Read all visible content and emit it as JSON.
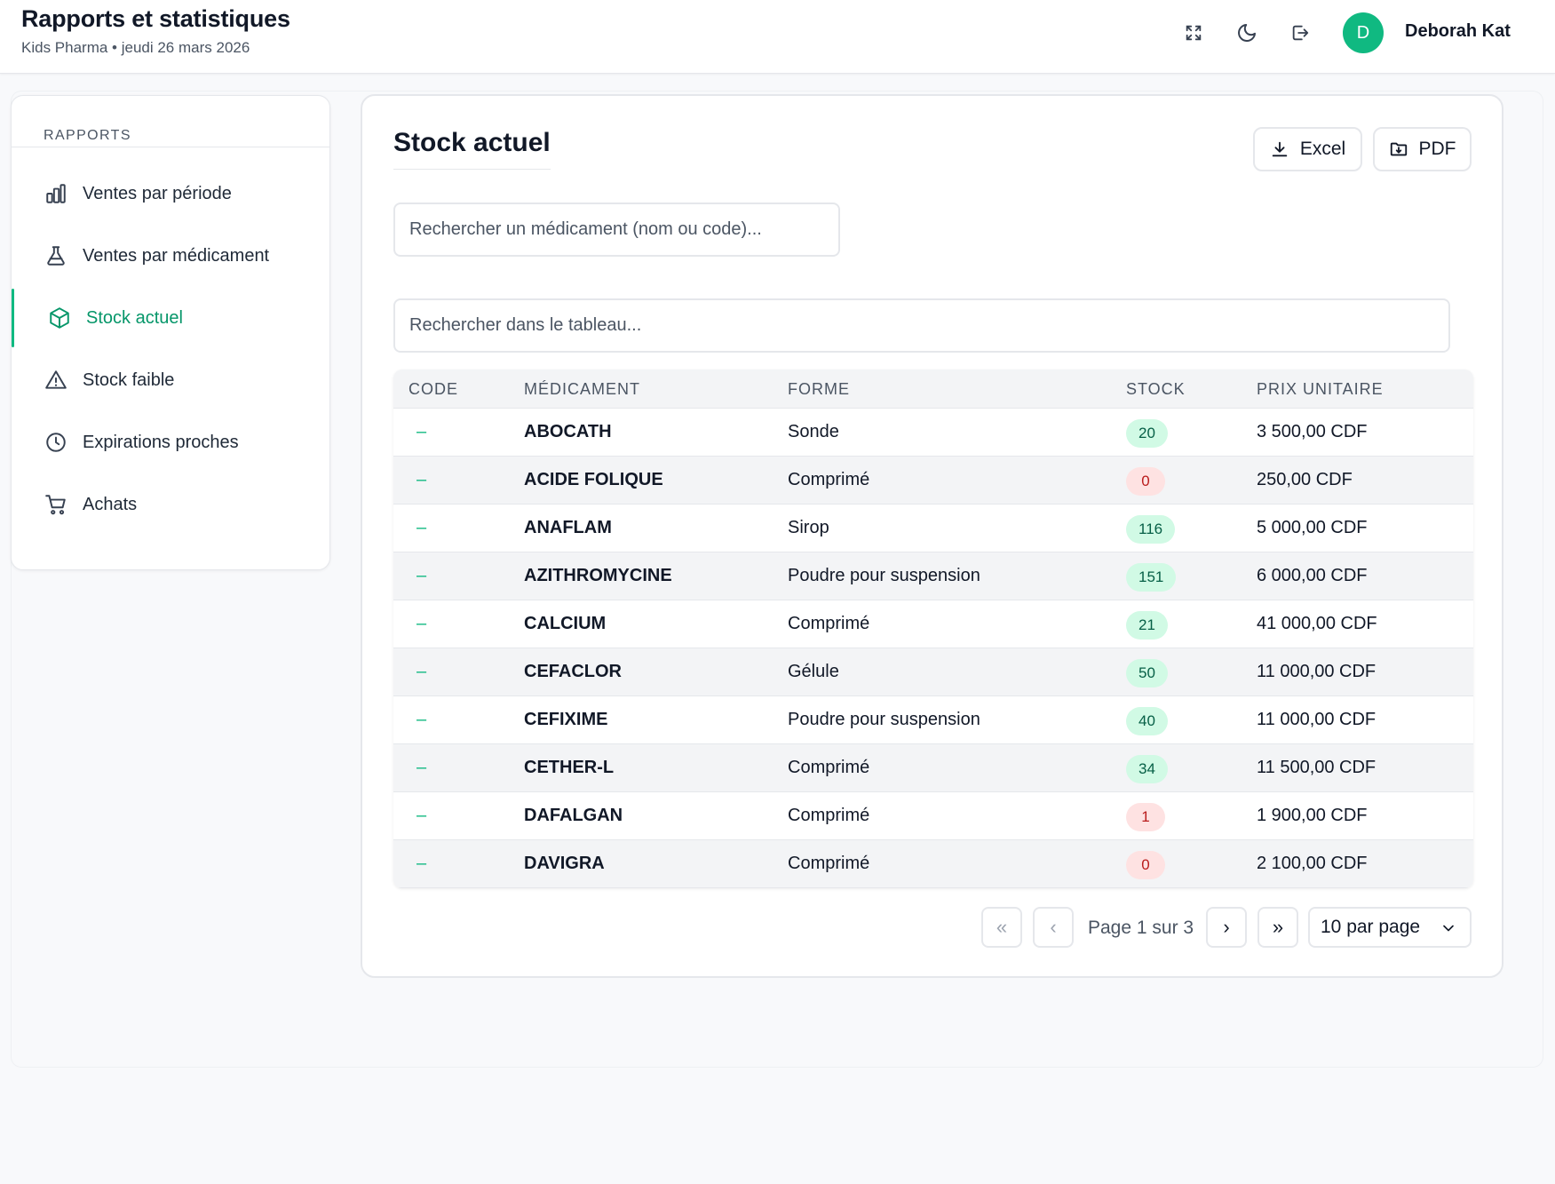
{
  "header": {
    "title": "Rapports et statistiques",
    "subtitle": "Kids Pharma • jeudi 26 mars 2026",
    "icons": [
      "fullscreen-icon",
      "moon-icon",
      "logout-icon"
    ],
    "avatar_initial": "D",
    "user_name": "Deborah Kat"
  },
  "sidebar": {
    "section_label": "RAPPORTS",
    "items": [
      {
        "label": "Ventes par période",
        "icon": "bar-chart-icon"
      },
      {
        "label": "Ventes par médicament",
        "icon": "flask-icon"
      },
      {
        "label": "Stock actuel",
        "icon": "box-icon",
        "active": true
      },
      {
        "label": "Stock faible",
        "icon": "warning-icon"
      },
      {
        "label": "Expirations proches",
        "icon": "clock-icon"
      },
      {
        "label": "Achats",
        "icon": "cart-icon"
      }
    ]
  },
  "main": {
    "title": "Stock actuel",
    "excel_label": "Excel",
    "pdf_label": "PDF",
    "search_medicament_placeholder": "Rechercher un médicament (nom ou code)...",
    "search_table_placeholder": "Rechercher dans le tableau...",
    "table": {
      "columns": [
        "CODE",
        "MÉDICAMENT",
        "FORME",
        "STOCK",
        "PRIX UNITAIRE"
      ],
      "rows": [
        {
          "code": "–",
          "name": "ABOCATH",
          "forme": "Sonde",
          "stock": "20",
          "price": "3 500,00 CDF",
          "level": "ok"
        },
        {
          "code": "–",
          "name": "ACIDE FOLIQUE",
          "forme": "Comprimé",
          "stock": "0",
          "price": "250,00 CDF",
          "level": "low"
        },
        {
          "code": "–",
          "name": "ANAFLAM",
          "forme": "Sirop",
          "stock": "116",
          "price": "5 000,00 CDF",
          "level": "ok"
        },
        {
          "code": "–",
          "name": "AZITHROMYCINE",
          "forme": "Poudre pour suspension",
          "stock": "151",
          "price": "6 000,00 CDF",
          "level": "ok"
        },
        {
          "code": "–",
          "name": "CALCIUM",
          "forme": "Comprimé",
          "stock": "21",
          "price": "41 000,00 CDF",
          "level": "ok"
        },
        {
          "code": "–",
          "name": "CEFACLOR",
          "forme": "Gélule",
          "stock": "50",
          "price": "11 000,00 CDF",
          "level": "ok"
        },
        {
          "code": "–",
          "name": "CEFIXIME",
          "forme": "Poudre pour suspension",
          "stock": "40",
          "price": "11 000,00 CDF",
          "level": "ok"
        },
        {
          "code": "–",
          "name": "CETHER-L",
          "forme": "Comprimé",
          "stock": "34",
          "price": "11 500,00 CDF",
          "level": "ok"
        },
        {
          "code": "–",
          "name": "DAFALGAN",
          "forme": "Comprimé",
          "stock": "1",
          "price": "1 900,00 CDF",
          "level": "low"
        },
        {
          "code": "–",
          "name": "DAVIGRA",
          "forme": "Comprimé",
          "stock": "0",
          "price": "2 100,00 CDF",
          "level": "low"
        }
      ]
    },
    "pagination": {
      "first": "«",
      "prev": "‹",
      "page_text": "Page 1 sur 3",
      "next": "›",
      "last": "»",
      "per_page": "10 par page"
    },
    "colors": {
      "accent": "#10b981",
      "stock_ok_bg": "#d1fae5",
      "stock_low_bg": "#fee2e2"
    }
  }
}
